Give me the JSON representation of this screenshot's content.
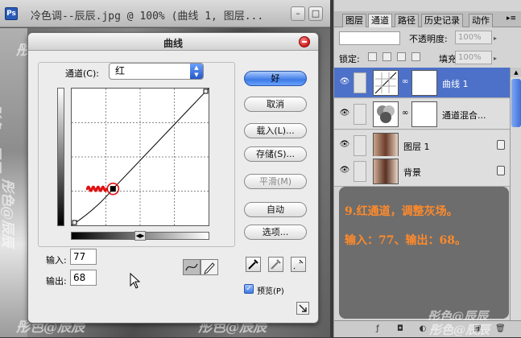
{
  "document": {
    "title": "冷色调--辰辰.jpg @ 100% (曲线 1, 图层...",
    "app_icon": "Ps",
    "minimize": "–",
    "maximize": "□"
  },
  "watermarks": [
    "彤色@辰辰",
    "彤色@辰辰",
    "彤色@辰辰",
    "彤色@辰辰",
    "彤色@辰辰",
    "彤色@辰辰",
    "彤色@辰辰"
  ],
  "curves_dialog": {
    "title": "曲线",
    "channel_label": "通道(C):",
    "channel_value": "红",
    "input_label": "输入:",
    "input_value": "77",
    "output_label": "输出:",
    "output_value": "68",
    "buttons": {
      "ok": "好",
      "cancel": "取消",
      "load": "载入(L)...",
      "save": "存储(S)...",
      "smooth": "平滑(M)",
      "auto": "自动",
      "options": "选项..."
    },
    "preview_label": "预览(P)",
    "preview_checked": true,
    "curve_point": {
      "input": 77,
      "output": 68
    }
  },
  "panel": {
    "tabs": [
      "图层",
      "通道",
      "路径",
      "历史记录",
      "动作"
    ],
    "active_tab": "通道",
    "opacity_label": "不透明度:",
    "opacity_value": "100%",
    "lock_label": "锁定:",
    "fill_label": "填充:",
    "fill_value": "100%",
    "layers": [
      {
        "name": "曲线 1",
        "type": "adjustment",
        "selected": true
      },
      {
        "name": "通道混合...",
        "type": "adjustment",
        "selected": false
      },
      {
        "name": "图层 1",
        "type": "image",
        "selected": false
      },
      {
        "name": "背景",
        "type": "image",
        "selected": false
      }
    ],
    "note": {
      "line1": "9.红通道，调整灰场。",
      "line2": "输入：77、输出：68。"
    },
    "footer_icons": [
      "link-icon",
      "fx-icon",
      "mask-icon",
      "adjustment-icon",
      "folder-icon",
      "new-layer-icon",
      "trash-icon"
    ]
  },
  "colors": {
    "selected_layer": "#4d71c9",
    "note_text": "#ff8a2a",
    "annotation_red": "#e01010"
  }
}
